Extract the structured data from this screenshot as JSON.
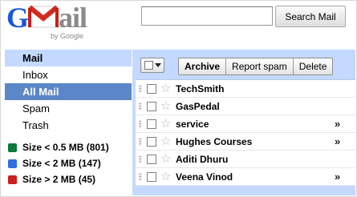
{
  "header": {
    "logo_g": "G",
    "logo_rest": "ail",
    "byline": "by Google",
    "search_button": "Search Mail",
    "search_value": ""
  },
  "sidebar": {
    "items": [
      {
        "label": "Mail",
        "state": "header"
      },
      {
        "label": "Inbox",
        "state": "normal"
      },
      {
        "label": "All Mail",
        "state": "selected"
      },
      {
        "label": "Spam",
        "state": "normal"
      },
      {
        "label": "Trash",
        "state": "normal"
      }
    ],
    "labels": [
      {
        "label": "Size < 0.5 MB (801)",
        "color": "#0b7a3b"
      },
      {
        "label": "Size < 2 MB (147)",
        "color": "#2f6fe0"
      },
      {
        "label": "Size > 2 MB (45)",
        "color": "#cc1f1f"
      }
    ]
  },
  "toolbar": {
    "archive": "Archive",
    "report_spam": "Report spam",
    "delete": "Delete"
  },
  "messages": [
    {
      "sender": "TechSmith",
      "more": ""
    },
    {
      "sender": "GasPedal",
      "more": ""
    },
    {
      "sender": "service",
      "more": "»"
    },
    {
      "sender": "Hughes Courses",
      "more": "»"
    },
    {
      "sender": "Aditi Dhuru",
      "more": ""
    },
    {
      "sender": "Veena Vinod",
      "more": "»"
    }
  ],
  "colors": {
    "accent": "#c3d9ff",
    "selected": "#5b86c8",
    "logo_blue": "#1a58d8"
  }
}
